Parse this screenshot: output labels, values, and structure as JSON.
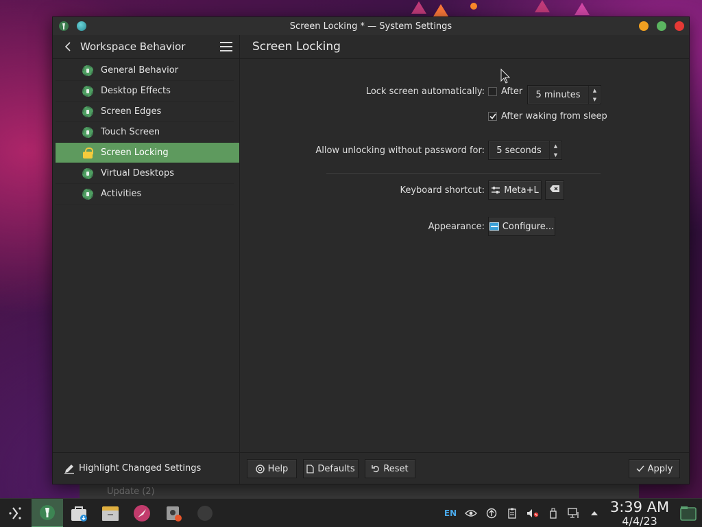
{
  "window": {
    "title": "Screen Locking * — System Settings"
  },
  "sidebar": {
    "title": "Workspace Behavior",
    "items": [
      {
        "label": "General Behavior",
        "icon": "settings-gear-icon",
        "active": false
      },
      {
        "label": "Desktop Effects",
        "icon": "settings-gear-icon",
        "active": false
      },
      {
        "label": "Screen Edges",
        "icon": "settings-gear-icon",
        "active": false
      },
      {
        "label": "Touch Screen",
        "icon": "settings-gear-icon",
        "active": false
      },
      {
        "label": "Screen Locking",
        "icon": "lock-icon",
        "active": true
      },
      {
        "label": "Virtual Desktops",
        "icon": "settings-gear-icon",
        "active": false
      },
      {
        "label": "Activities",
        "icon": "settings-gear-icon",
        "active": false
      }
    ],
    "footer_label": "Highlight Changed Settings"
  },
  "main": {
    "title": "Screen Locking",
    "lock_auto_label": "Lock screen automatically:",
    "after_label": "After",
    "after_checked": false,
    "lock_minutes_value": "5 minutes",
    "after_sleep_label": "After waking from sleep",
    "after_sleep_checked": true,
    "unlock_label": "Allow unlocking without password for:",
    "unlock_value": "5 seconds",
    "shortcut_label": "Keyboard shortcut:",
    "shortcut_value": "Meta+L",
    "appearance_label": "Appearance:",
    "configure_label": "Configure..."
  },
  "footer": {
    "help": "Help",
    "defaults": "Defaults",
    "reset": "Reset",
    "apply": "Apply"
  },
  "background_window": {
    "update_text": "Update (2)"
  },
  "taskbar": {
    "apps": [
      "app-launcher-icon",
      "system-settings-icon",
      "discover-store-icon",
      "file-manager-icon",
      "web-browser-icon",
      "settings-app-icon",
      "blank-app-icon"
    ],
    "tray": {
      "language": "EN",
      "time": "3:39 AM",
      "date": "4/4/23"
    }
  },
  "colors": {
    "accent": "#5e9a5e",
    "window_bg": "#2a2a2a",
    "close": "#e53935",
    "maximize": "#5bb560",
    "minimize": "#f0a020"
  }
}
